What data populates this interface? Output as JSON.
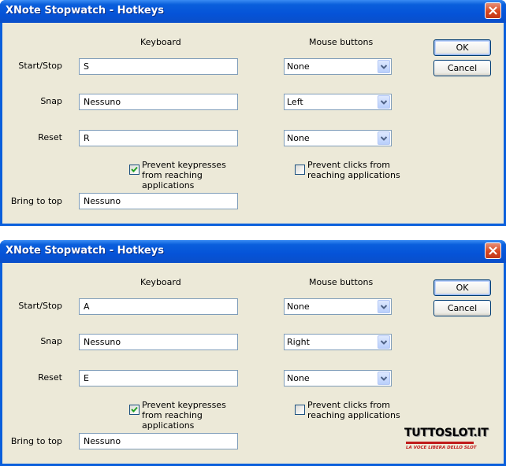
{
  "windows": [
    {
      "title": "XNote Stopwatch - Hotkeys",
      "keyboard_header": "Keyboard",
      "mouse_header": "Mouse buttons",
      "rows": [
        {
          "label": "Start/Stop",
          "key": "S",
          "mouse": "None"
        },
        {
          "label": "Snap",
          "key": "Nessuno",
          "mouse": "Left"
        },
        {
          "label": "Reset",
          "key": "R",
          "mouse": "None"
        }
      ],
      "prevent_keys": {
        "label": "Prevent keypresses from reaching applications",
        "checked": true
      },
      "prevent_clicks": {
        "label": "Prevent clicks from reaching applications",
        "checked": false
      },
      "bring_to_top": {
        "label": "Bring to top",
        "key": "Nessuno"
      },
      "ok_label": "OK",
      "cancel_label": "Cancel"
    },
    {
      "title": "XNote Stopwatch - Hotkeys",
      "keyboard_header": "Keyboard",
      "mouse_header": "Mouse buttons",
      "rows": [
        {
          "label": "Start/Stop",
          "key": "A",
          "mouse": "None"
        },
        {
          "label": "Snap",
          "key": "Nessuno",
          "mouse": "Right"
        },
        {
          "label": "Reset",
          "key": "E",
          "mouse": "None"
        }
      ],
      "prevent_keys": {
        "label": "Prevent keypresses from reaching applications",
        "checked": true
      },
      "prevent_clicks": {
        "label": "Prevent clicks from reaching applications",
        "checked": false
      },
      "bring_to_top": {
        "label": "Bring to top",
        "key": "Nessuno"
      },
      "ok_label": "OK",
      "cancel_label": "Cancel"
    }
  ],
  "watermark": {
    "brand": "TUTTOSLOT.IT",
    "tagline": "LA VOCE LIBERA DELLO SLOT",
    "brand_color": "#000000",
    "accent_color": "#c01a1a"
  },
  "colors": {
    "titlebar": "#0a5fdc",
    "client_bg": "#ece9d8",
    "close_button": "#d6461f"
  }
}
